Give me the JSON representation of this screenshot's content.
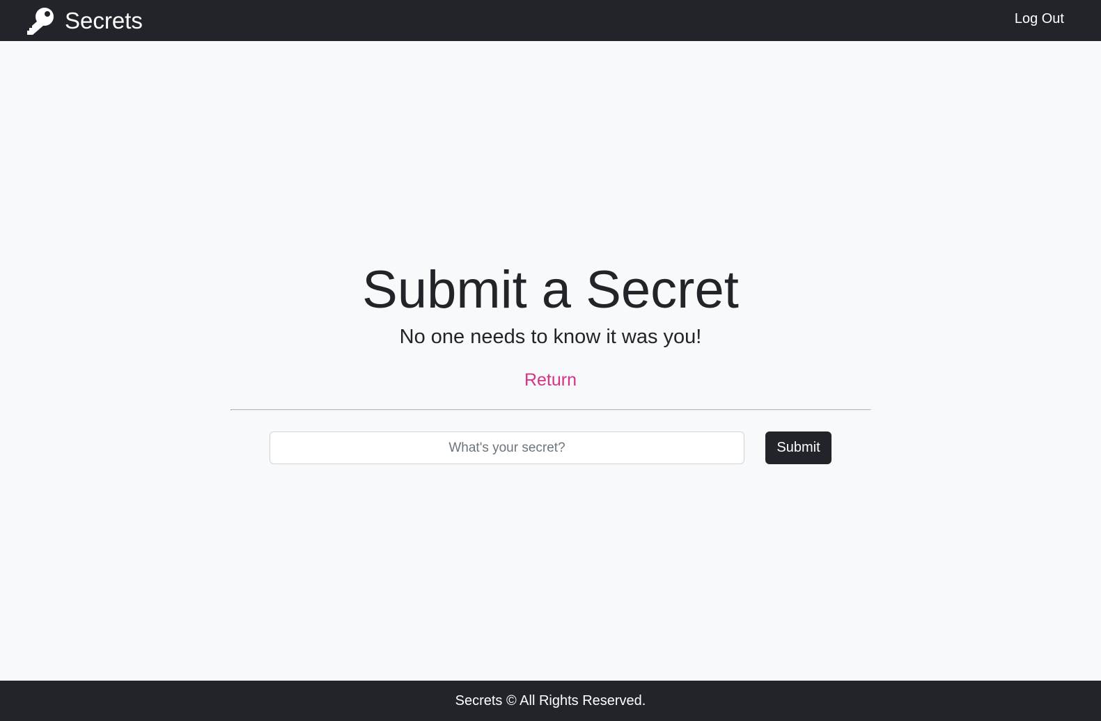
{
  "navbar": {
    "brand_icon": "key-icon",
    "brand_text": "Secrets",
    "logout_label": "Log Out"
  },
  "main": {
    "heading": "Submit a Secret",
    "subheading": "No one needs to know it was you!",
    "return_label": "Return",
    "form": {
      "secret_placeholder": "What's your secret?",
      "secret_value": "",
      "submit_label": "Submit"
    }
  },
  "footer": {
    "text": "Secrets © All Rights Reserved."
  },
  "colors": {
    "navbar_bg": "#212529",
    "page_bg": "#f8f9fa",
    "link_accent": "#d63384",
    "button_bg": "#212529"
  }
}
